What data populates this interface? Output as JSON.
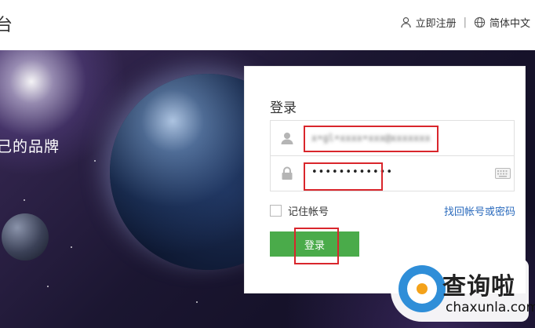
{
  "header": {
    "brand_fragment": "台",
    "register_label": "立即注册",
    "separator": "|",
    "language_label": "简体中文"
  },
  "hero": {
    "slogan_fragment": "己的品牌"
  },
  "login": {
    "title": "登录",
    "username_value": "x•gl•xxxx•xxx@xxxxxxx",
    "password_value": "••••••••••••",
    "remember_label": "记住帐号",
    "forgot_label": "找回帐号或密码",
    "submit_label": "登录"
  },
  "watermark": {
    "cn": "查询啦",
    "en": "chaxunla.com"
  },
  "colors": {
    "button_green": "#4aab4a",
    "highlight_red": "#d9262c",
    "link_blue": "#2b6bbd"
  },
  "icons": [
    "user-icon",
    "globe-icon",
    "person-icon",
    "lock-icon",
    "keyboard-icon",
    "search-logo-icon"
  ]
}
